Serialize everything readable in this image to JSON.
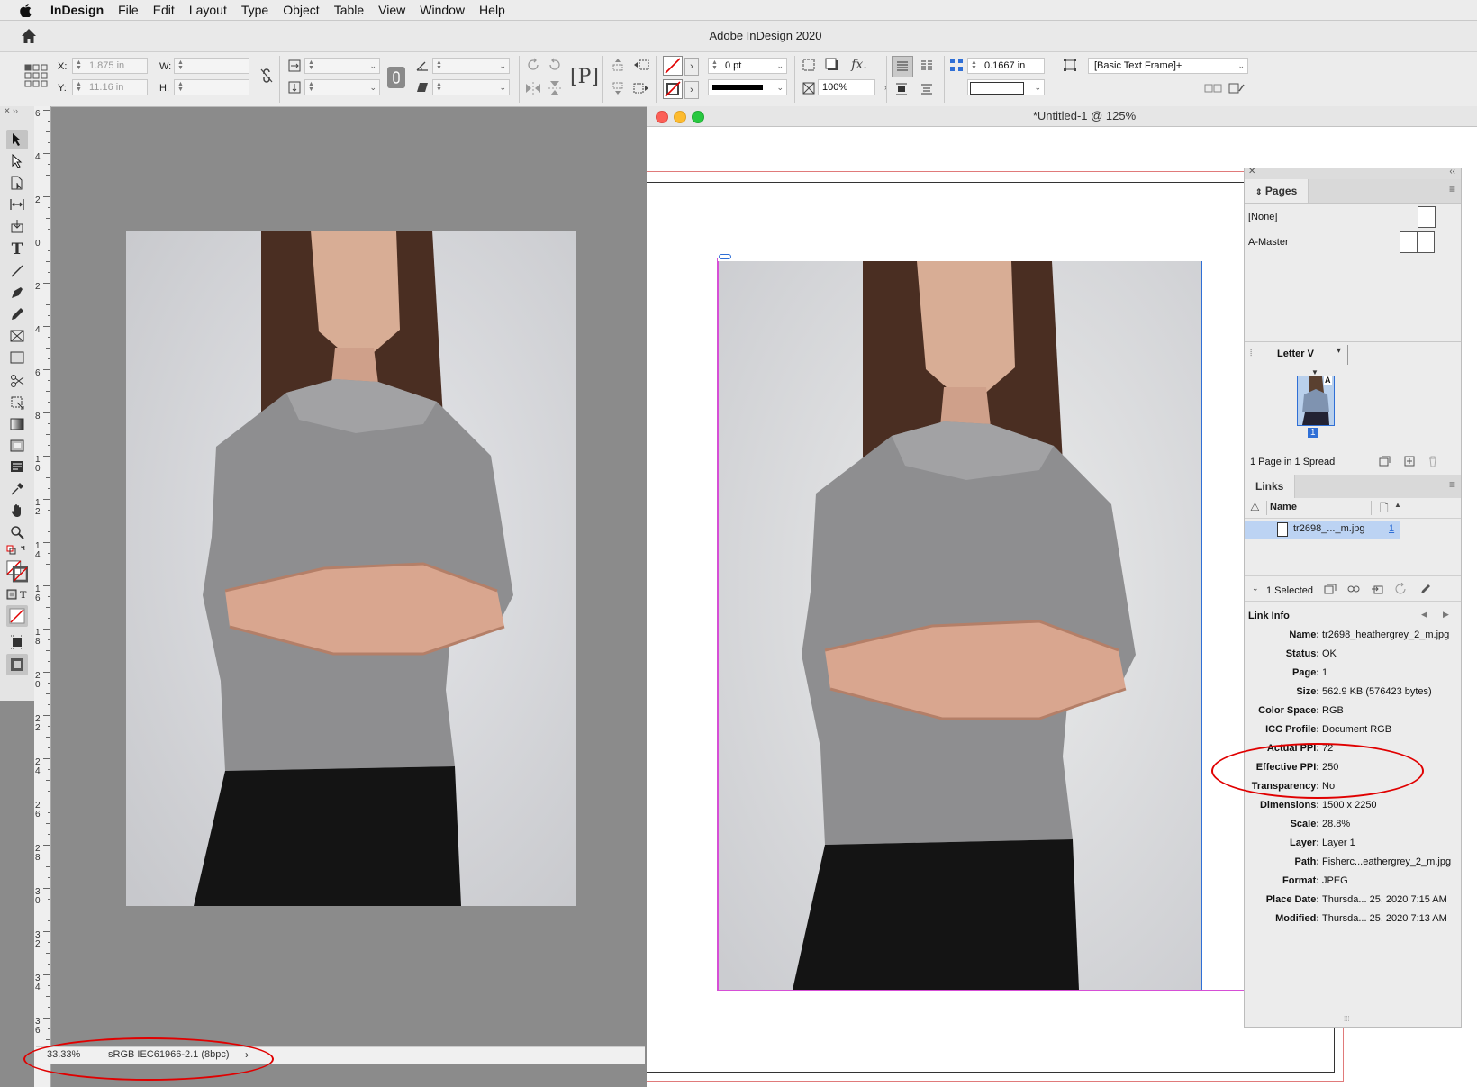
{
  "menubar": {
    "items": [
      "InDesign",
      "File",
      "Edit",
      "Layout",
      "Type",
      "Object",
      "Table",
      "View",
      "Window",
      "Help"
    ]
  },
  "app": {
    "title": "Adobe InDesign 2020"
  },
  "control": {
    "x_label": "X:",
    "x_value": "1.875 in",
    "y_label": "Y:",
    "y_value": "11.16 in",
    "w_label": "W:",
    "h_label": "H:",
    "stroke_weight": "0 pt",
    "opacity": "100%",
    "spacing": "0.1667 in",
    "object_style": "[Basic Text Frame]+"
  },
  "left_view": {
    "zoom": "33.33%",
    "profile": "sRGB IEC61966-2.1 (8bpc)",
    "ruler_labels": [
      "6",
      "4",
      "2",
      "0",
      "2",
      "4",
      "6",
      "8",
      "1\n0",
      "1\n2",
      "1\n4",
      "1\n6",
      "1\n8",
      "2\n0",
      "2\n2",
      "2\n4",
      "2\n6",
      "2\n8",
      "3\n0",
      "3\n2",
      "3\n4",
      "3\n6"
    ]
  },
  "document": {
    "title": "*Untitled-1 @ 125%"
  },
  "pages_panel": {
    "tab": "Pages",
    "none_label": "[None]",
    "master_label": "A-Master",
    "page_size": "Letter V",
    "thumb_master": "A",
    "page_number": "1",
    "footer": "1 Page in 1 Spread"
  },
  "links_panel": {
    "tab": "Links",
    "name_header": "Name",
    "file_name": "tr2698_..._m.jpg",
    "file_page": "1",
    "selected": "1 Selected",
    "link_info_title": "Link Info",
    "info": [
      {
        "key": "Name:",
        "value": "tr2698_heathergrey_2_m.jpg"
      },
      {
        "key": "Status:",
        "value": "OK"
      },
      {
        "key": "Page:",
        "value": "1"
      },
      {
        "key": "Size:",
        "value": "562.9 KB (576423 bytes)"
      },
      {
        "key": "Color Space:",
        "value": "RGB"
      },
      {
        "key": "ICC Profile:",
        "value": "Document RGB"
      },
      {
        "key": "Actual PPI:",
        "value": "72"
      },
      {
        "key": "Effective PPI:",
        "value": "250"
      },
      {
        "key": "Transparency:",
        "value": "No"
      },
      {
        "key": "Dimensions:",
        "value": "1500 x 2250"
      },
      {
        "key": "Scale:",
        "value": "28.8%"
      },
      {
        "key": "Layer:",
        "value": "Layer 1"
      },
      {
        "key": "Path:",
        "value": "Fisherc...eathergrey_2_m.jpg"
      },
      {
        "key": "Format:",
        "value": "JPEG"
      },
      {
        "key": "Place Date:",
        "value": "Thursda... 25, 2020 7:15 AM"
      },
      {
        "key": "Modified:",
        "value": "Thursda... 25, 2020 7:13 AM"
      }
    ]
  },
  "colors": {
    "annotation_red": "#e00000",
    "selection_blue": "#2f6fd6",
    "frame_magenta": "#d64fd6"
  }
}
